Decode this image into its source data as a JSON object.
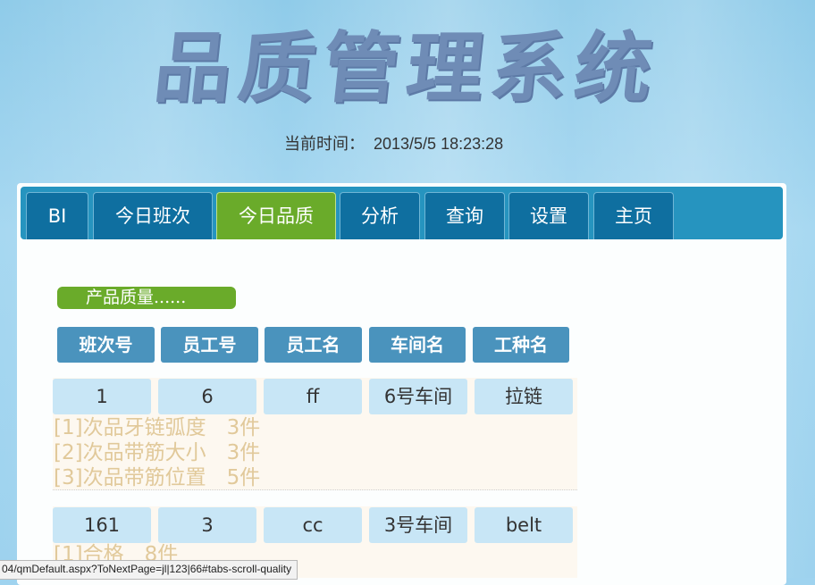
{
  "header": {
    "title": "品质管理系统",
    "time_label": "当前时间：",
    "time_value": "2013/5/5 18:23:28"
  },
  "tabs": [
    {
      "label": "BI",
      "active": false
    },
    {
      "label": "今日班次",
      "active": false
    },
    {
      "label": "今日品质",
      "active": true
    },
    {
      "label": "分析",
      "active": false
    },
    {
      "label": "查询",
      "active": false
    },
    {
      "label": "设置",
      "active": false
    },
    {
      "label": "主页",
      "active": false
    }
  ],
  "section": {
    "title": "产品质量......"
  },
  "columns": [
    "班次号",
    "员工号",
    "员工名",
    "车间名",
    "工种名"
  ],
  "records": [
    {
      "cells": [
        "1",
        "6",
        "ff",
        "6号车间",
        "拉链"
      ],
      "details": [
        "[1]次品牙链弧度　3件",
        "[2]次品带筋大小　3件",
        "[3]次品带筋位置　5件"
      ]
    },
    {
      "cells": [
        "161",
        "3",
        "cc",
        "3号车间",
        "belt"
      ],
      "details": [
        "[1]合格　8件"
      ]
    }
  ],
  "status_bar": {
    "url": "04/qmDefault.aspx?ToNextPage=jl|123|66#tabs-scroll-quality"
  },
  "colors": {
    "tab_bar": "#2694bf",
    "tab": "#0f6fa0",
    "tab_active": "#6aab2a",
    "header_cell": "#4a93bd",
    "data_cell": "#c8e6f6",
    "detail_text": "#e1c99a"
  }
}
